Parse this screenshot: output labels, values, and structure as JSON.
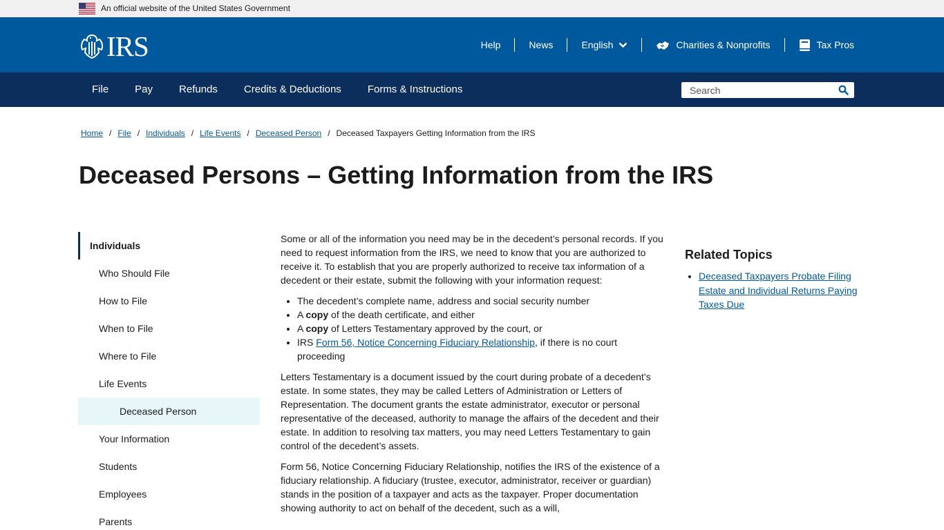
{
  "gov_banner": {
    "text": "An official website of the United States Government"
  },
  "header": {
    "logo_text": "IRS",
    "links": [
      {
        "label": "Help"
      },
      {
        "label": "News"
      },
      {
        "label": "English"
      },
      {
        "label": "Charities & Nonprofits",
        "icon": "handshake-icon"
      },
      {
        "label": "Tax Pros",
        "icon": "book-icon"
      }
    ]
  },
  "nav": {
    "items": [
      "File",
      "Pay",
      "Refunds",
      "Credits & Deductions",
      "Forms & Instructions"
    ],
    "search_placeholder": "Search"
  },
  "breadcrumb": {
    "links": [
      "Home",
      "File",
      "Individuals",
      "Life Events",
      "Deceased Person"
    ],
    "separator": "/",
    "current": "Deceased Taxpayers Getting Information from the IRS"
  },
  "page_title": "Deceased Persons – Getting Information from the IRS",
  "sidebar": {
    "heading": "Individuals",
    "items": [
      "Who Should File",
      "How to File",
      "When to File",
      "Where to File",
      "Life Events"
    ],
    "sub_item": "Deceased Person",
    "items_after": [
      "Your Information",
      "Students",
      "Employees",
      "Parents"
    ]
  },
  "content": {
    "intro": "Some or all of the information you need may be in the decedent’s personal records. If you need to request information from the IRS, we need to know that you are authorized to receive it. To establish that you are properly authorized to receive tax information of a decedent or their estate, submit the following with your information request:",
    "bullet1": "The decedent’s complete name, address and social security number",
    "bullet2_pre": "A ",
    "bullet2_bold": "copy",
    "bullet2_post": " of the death certificate, and either",
    "bullet3_pre": "A ",
    "bullet3_bold": "copy",
    "bullet3_post": " of Letters Testamentary approved by the court, or",
    "bullet4_pre": "IRS ",
    "bullet4_link": "Form 56, Notice Concerning Fiduciary Relationship",
    "bullet4_post": ", if there is no court proceeding",
    "para2": "Letters Testamentary is a document issued by the court during probate of a decedent’s estate. In some states, they may be called Letters of Administration or Letters of Representation. The document grants the estate administrator, executor or personal representative of the deceased, authority to manage the affairs of the decedent and their estate. In addition to resolving tax matters, you may need Letters Testamentary to gain control of the decedent’s assets.",
    "para3": "Form 56, Notice Concerning Fiduciary Relationship, notifies the IRS of the existence of a fiduciary relationship. A fiduciary (trustee, executor, administrator, receiver or guardian) stands in the position of a taxpayer and acts as the taxpayer. Proper documentation showing authority to act on behalf of the decedent, such as a will,"
  },
  "related": {
    "heading": "Related Topics",
    "link": "Deceased Taxpayers Probate Filing Estate and Individual Returns Paying Taxes Due"
  },
  "colors": {
    "header_blue": "#00599c",
    "nav_navy": "#0b2e5c",
    "link_blue": "#00599c",
    "sidebar_active_bg": "#e7f6f8"
  }
}
